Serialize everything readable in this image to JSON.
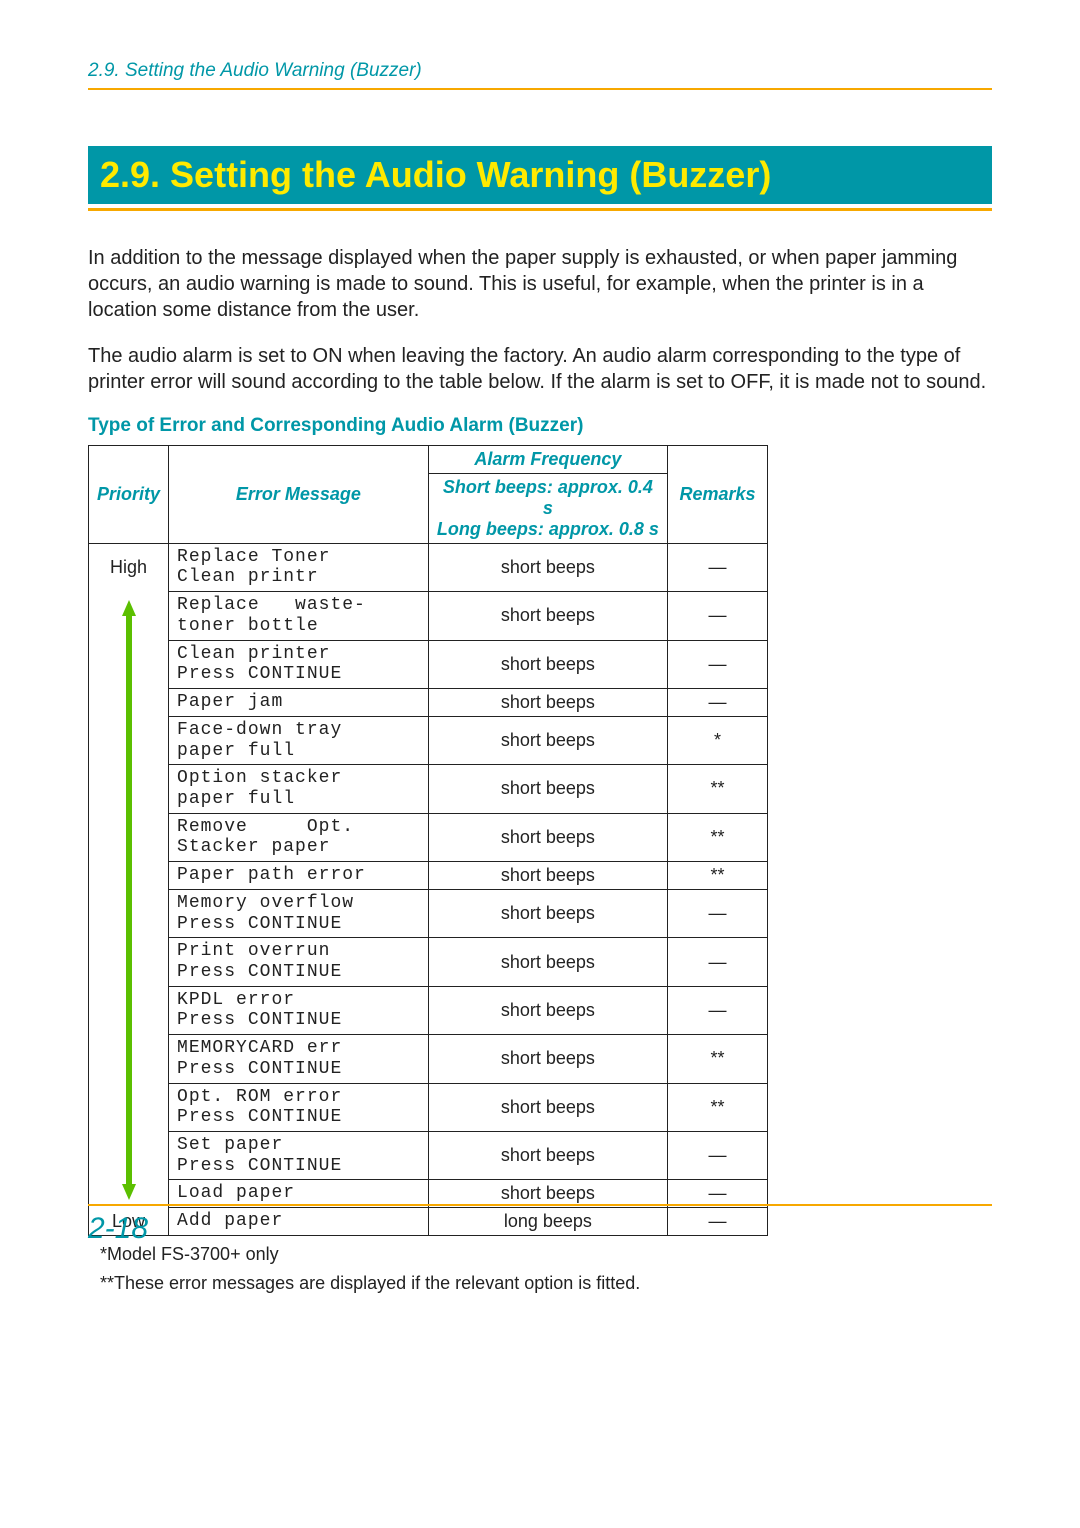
{
  "running_header": "2.9.  Setting the Audio Warning (Buzzer)",
  "section_title": "2.9.  Setting the Audio Warning (Buzzer)",
  "para1": "In addition to the message displayed when the paper supply is exhausted, or when paper jamming occurs, an audio warning is made to sound. This is useful, for example, when the printer is in a location some distance from the user.",
  "para2": "The audio alarm is set to ON when leaving the factory. An audio alarm corresponding to the type of printer error will sound according to the table below. If the alarm is set to OFF, it is made not to sound.",
  "table_caption": "Type of Error and Corresponding Audio Alarm (Buzzer)",
  "headers": {
    "priority": "Priority",
    "error_message": "Error Message",
    "alarm_frequency": "Alarm Frequency",
    "alarm_sub": "Short beeps: approx. 0.4 s\nLong beeps: approx. 0.8 s",
    "remarks": "Remarks"
  },
  "priority_high": "High",
  "priority_low": "Low",
  "rows": [
    {
      "msg": "Replace Toner\nClean printr",
      "alarm": "short beeps",
      "remark": "—"
    },
    {
      "msg": "Replace   waste-\ntoner bottle",
      "alarm": "short beeps",
      "remark": "—"
    },
    {
      "msg": "Clean printer\nPress CONTINUE",
      "alarm": "short beeps",
      "remark": "—"
    },
    {
      "msg": "Paper jam",
      "alarm": "short beeps",
      "remark": "—"
    },
    {
      "msg": "Face-down tray\npaper full",
      "alarm": "short beeps",
      "remark": "*"
    },
    {
      "msg": "Option stacker\npaper full",
      "alarm": "short beeps",
      "remark": "**"
    },
    {
      "msg": "Remove     Opt.\nStacker paper",
      "alarm": "short beeps",
      "remark": "**"
    },
    {
      "msg": "Paper path error",
      "alarm": "short beeps",
      "remark": "**"
    },
    {
      "msg": "Memory overflow\nPress CONTINUE",
      "alarm": "short beeps",
      "remark": "—"
    },
    {
      "msg": "Print overrun\nPress CONTINUE",
      "alarm": "short beeps",
      "remark": "—"
    },
    {
      "msg": "KPDL error\nPress CONTINUE",
      "alarm": "short beeps",
      "remark": "—"
    },
    {
      "msg": "MEMORYCARD err\nPress CONTINUE",
      "alarm": "short beeps",
      "remark": "**"
    },
    {
      "msg": "Opt. ROM error\nPress CONTINUE",
      "alarm": "short beeps",
      "remark": "**"
    },
    {
      "msg": "Set paper\nPress CONTINUE",
      "alarm": "short beeps",
      "remark": "—"
    },
    {
      "msg": "Load paper",
      "alarm": "short beeps",
      "remark": "—"
    },
    {
      "msg": "Add paper",
      "alarm": "long beeps",
      "remark": "—"
    }
  ],
  "footnote1": "*Model FS-3700+ only",
  "footnote2": "**These error messages are displayed if the relevant option is fitted.",
  "page_number": "2-18"
}
